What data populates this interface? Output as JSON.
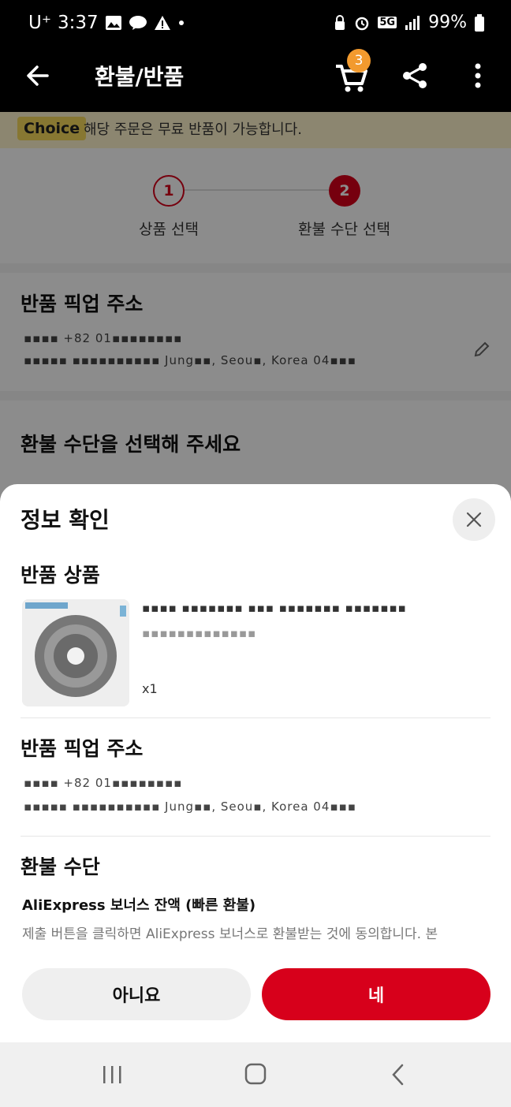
{
  "status_bar": {
    "carrier": "U⁺",
    "time": "3:37",
    "network": "5G",
    "battery": "99%"
  },
  "app_bar": {
    "title": "환불/반품",
    "cart_count": "3"
  },
  "banner": {
    "tag": "Choice",
    "text": "해당 주문은 무료 반품이 가능합니다."
  },
  "steps": [
    {
      "number": "1",
      "label": "상품 선택"
    },
    {
      "number": "2",
      "label": "환불 수단 선택"
    }
  ],
  "background": {
    "pickup_title": "반품 픽업 주소",
    "address_line1": "▪▪▪▪ +82 01▪▪▪▪▪▪▪▪",
    "address_line2": "▪▪▪▪▪ ▪▪▪▪▪▪▪▪▪▪ Jung▪▪, Seou▪, Korea 04▪▪▪",
    "method_title": "환불 수단을 선택해 주세요"
  },
  "sheet": {
    "title": "정보 확인",
    "product_heading": "반품 상품",
    "product_name": "▪▪▪▪ ▪▪▪▪▪▪▪ ▪▪▪ ▪▪▪▪▪▪▪ ▪▪▪▪▪▪▪",
    "product_variant": "▪▪▪▪▪▪▪▪▪▪▪▪▪",
    "product_qty": "x1",
    "pickup_heading": "반품 픽업 주소",
    "pickup_line1": "▪▪▪▪ +82 01▪▪▪▪▪▪▪▪",
    "pickup_line2": "▪▪▪▪▪ ▪▪▪▪▪▪▪▪▪▪ Jung▪▪, Seou▪, Korea 04▪▪▪",
    "refund_heading": "환불 수단",
    "refund_method": "AliExpress 보너스 잔액 (빠른 환불)",
    "refund_notice": "제출 버튼을 클릭하면 AliExpress 보너스로 환불받는 것에 동의합니다. 본",
    "no_label": "아니요",
    "yes_label": "네"
  },
  "colors": {
    "accent": "#d7001b",
    "badge": "#f29a2e"
  }
}
